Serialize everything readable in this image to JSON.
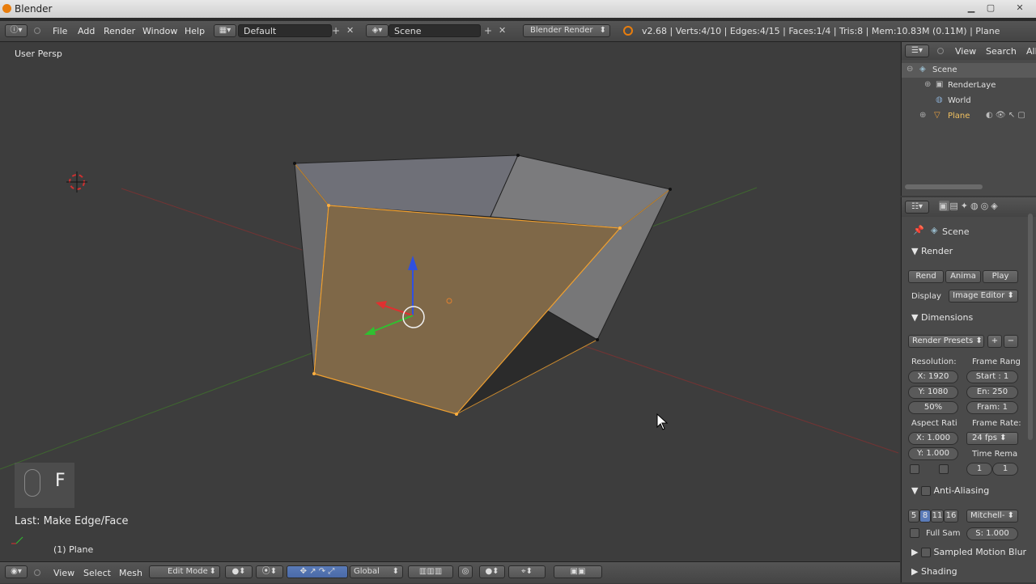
{
  "window": {
    "title": "Blender"
  },
  "topbar": {
    "menus": [
      "File",
      "Add",
      "Render",
      "Window",
      "Help"
    ],
    "screen_layout": "Default",
    "scene": "Scene",
    "engine": "Blender Render",
    "stats": "v2.68 | Verts:4/10 | Edges:4/15 | Faces:1/4 | Tris:8 | Mem:10.83M (0.11M) | Plane"
  },
  "viewport": {
    "view_name": "User Persp",
    "key_shown": "F",
    "last_op": "Last: Make Edge/Face",
    "object_label": "(1) Plane",
    "colors": {
      "face_selected": "#7f6848",
      "edge_selected": "#f0a030",
      "background": "#3d3d3d"
    }
  },
  "bottombar": {
    "menus": [
      "View",
      "Select",
      "Mesh"
    ],
    "mode": "Edit Mode",
    "orientation": "Global"
  },
  "outliner": {
    "header": {
      "view": "View",
      "search": "Search",
      "all": "All"
    },
    "items": [
      "Scene",
      "RenderLaye",
      "World",
      "Plane"
    ]
  },
  "properties": {
    "context": "Scene",
    "render": {
      "title": "Render",
      "buttons": [
        "Rend",
        "Anima",
        "Play"
      ],
      "display_label": "Display",
      "display_value": "Image Editor"
    },
    "dimensions": {
      "title": "Dimensions",
      "presets": "Render Presets",
      "resolution_label": "Resolution:",
      "res_x": "X: 1920",
      "res_y": "Y: 1080",
      "res_pct": "50%",
      "frame_range_label": "Frame Rang",
      "start": "Start : 1",
      "end": "En: 250",
      "frame_step": "Fram: 1",
      "aspect_label": "Aspect Rati",
      "aspect_x": "X: 1.000",
      "aspect_y": "Y: 1.000",
      "frame_rate_label": "Frame Rate:",
      "fps": "24 fps",
      "time_remap_label": "Time Rema",
      "remap_old": "1",
      "remap_new": "1"
    },
    "antialiasing": {
      "title": "Anti-Aliasing",
      "samples": [
        "5",
        "8",
        "11",
        "16"
      ],
      "filter": "Mitchell-",
      "full_sample": "Full Sam",
      "size": "S: 1.000"
    },
    "collapsed": [
      "Sampled Motion Blur",
      "Shading"
    ]
  }
}
